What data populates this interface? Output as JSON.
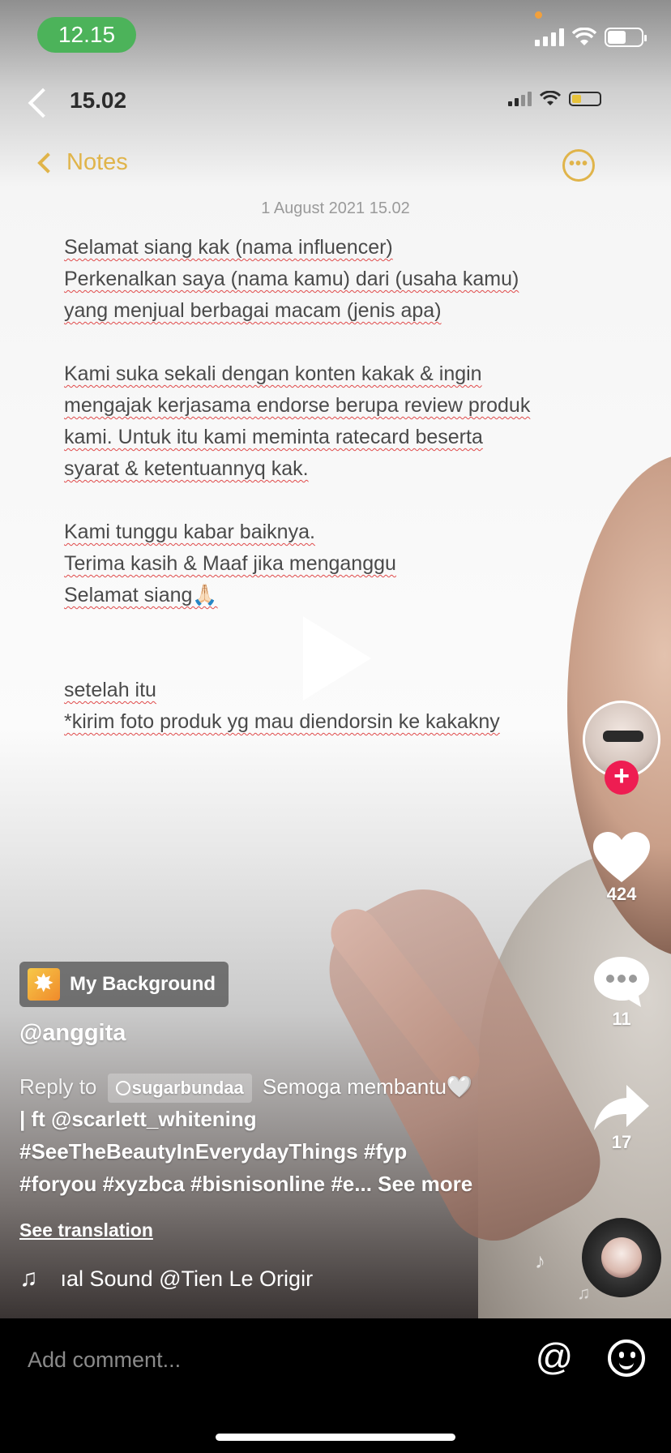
{
  "status_bar": {
    "time": "12.15"
  },
  "video": {
    "inner_status": {
      "time": "15.02"
    },
    "notes": {
      "back_label": "Notes",
      "date": "1 August 2021 15.02",
      "lines": [
        "Selamat siang kak (nama influencer)",
        "Perkenalkan saya (nama kamu) dari (usaha kamu)",
        "yang menjual berbagai macam (jenis apa)",
        "Kami suka sekali dengan konten kakak & ingin",
        "mengajak kerjasama endorse berupa review produk",
        "kami. Untuk itu kami meminta ratecard beserta",
        "syarat & ketentuannyq kak.",
        "Kami tunggu kabar baiknya.",
        "Terima kasih & Maaf jika menganggu",
        "Selamat siang🙏🏻",
        "setelah itu",
        "*kirim foto produk yg mau diendorsin ke kakakny"
      ]
    }
  },
  "actions": {
    "likes": "424",
    "comments": "11",
    "shares": "17"
  },
  "effect": {
    "label": "My Background"
  },
  "author": {
    "username": "@anggita"
  },
  "caption": {
    "reply_label": "Reply to",
    "reply_user": "sugarbundaa",
    "line1_text": "Semoga membantu🤍",
    "line2": "| ft @scarlett_whitening",
    "line3": "#SeeTheBeautyInEverydayThings #fyp",
    "line4": "#foryou #xyzbca #bisnisonline #e...",
    "see_more": "See more"
  },
  "see_translation": "See translation",
  "sound": {
    "text": "ıal Sound    @Tien Le Origir"
  },
  "comment_bar": {
    "placeholder": "Add comment..."
  },
  "icons": {
    "back": "chevron-left-icon",
    "like": "heart-icon",
    "comment": "comment-bubble-icon",
    "share": "share-arrow-icon",
    "music": "music-note-icon",
    "mention": "at-icon",
    "emoji": "emoji-icon"
  },
  "colors": {
    "time_pill": "#4cb35a",
    "notes_accent": "#e0b44a",
    "follow": "#ee1d52"
  }
}
